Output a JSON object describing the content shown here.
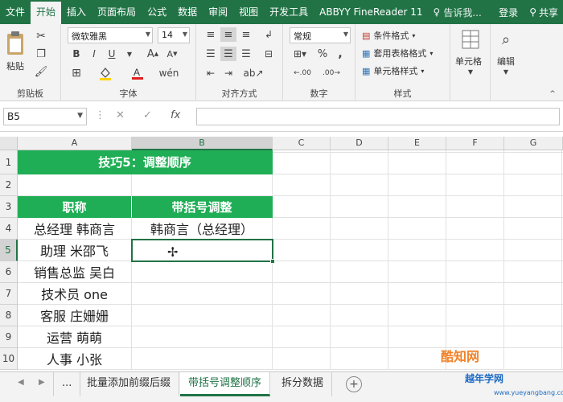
{
  "menu": {
    "tabs": [
      "文件",
      "开始",
      "插入",
      "页面布局",
      "公式",
      "数据",
      "审阅",
      "视图",
      "开发工具",
      "ABBYY FineReader 11"
    ],
    "active_tab": "开始",
    "tell_me": "告诉我...",
    "login": "登录",
    "share": "共享"
  },
  "ribbon": {
    "clipboard": {
      "paste": "粘贴",
      "label": "剪贴板"
    },
    "font": {
      "name": "微软雅黑",
      "size": "14",
      "bold": "B",
      "italic": "I",
      "underline": "U",
      "label": "字体"
    },
    "alignment": {
      "label": "对齐方式"
    },
    "number": {
      "format": "常规",
      "percent": "%",
      "comma": ",",
      "label": "数字"
    },
    "styles": {
      "conditional": "条件格式",
      "table": "套用表格格式",
      "cell_style": "单元格样式",
      "label": "样式"
    },
    "cells": {
      "label": "单元格"
    },
    "editing": {
      "label": "编辑"
    }
  },
  "formula_bar": {
    "name_box": "B5",
    "fx": "fx",
    "value": ""
  },
  "sheet": {
    "columns": [
      "A",
      "B",
      "C",
      "D",
      "E",
      "F",
      "G"
    ],
    "rows": [
      "1",
      "2",
      "3",
      "4",
      "5",
      "6",
      "7",
      "8",
      "9",
      "10"
    ],
    "selected_col": "B",
    "selected_row": "5",
    "title": "技巧5：调整顺序",
    "header_a": "职称",
    "header_b": "带括号调整",
    "col_a": [
      "总经理 韩商言",
      "助理 米邵飞",
      "销售总监 吴白",
      "技术员 one",
      "客服 庄姗姗",
      "运营 萌萌",
      "人事 小张"
    ],
    "col_b": [
      "韩商言（总经理）"
    ]
  },
  "tabs": {
    "ellipsis": "...",
    "sheets": [
      "批量添加前缀后缀",
      "带括号调整顺序",
      "拆分数据"
    ],
    "active": "带括号调整顺序"
  },
  "watermark": {
    "line1": "酷知网",
    "line2": "越年学网",
    "line3": "www.yueyangbang.com"
  }
}
